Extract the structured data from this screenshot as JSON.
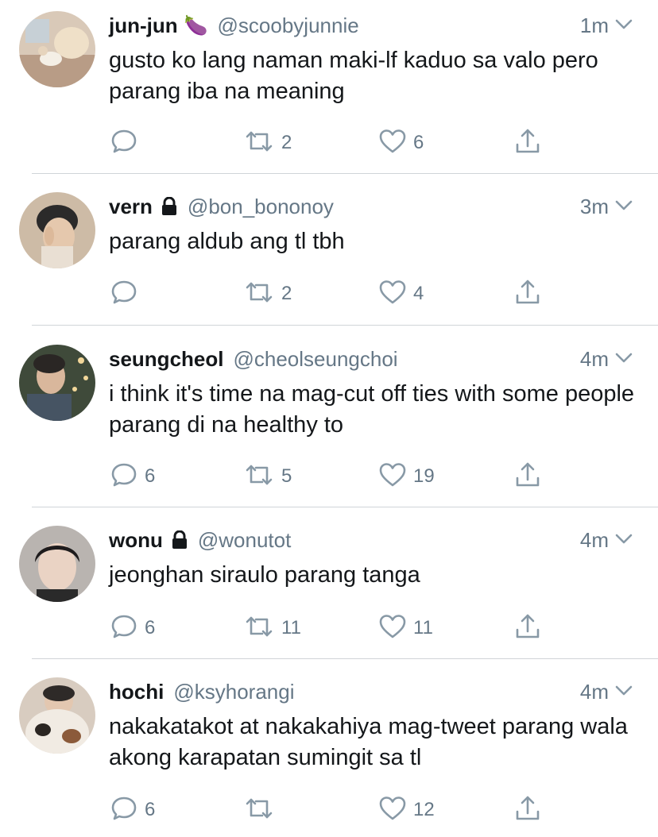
{
  "colors": {
    "name": "#14171a",
    "secondary": "#657786",
    "icon": "#8899a6",
    "divider": "#d0d4d8"
  },
  "tweets": [
    {
      "name": "jun-jun",
      "emoji": "🍆",
      "locked": false,
      "handle": "@scoobyjunnie",
      "time": "1m",
      "text": "gusto ko lang naman maki-lf kaduo sa valo pero parang iba na meaning",
      "replies": "",
      "retweets": "2",
      "likes": "6"
    },
    {
      "name": "vern",
      "emoji": "",
      "locked": true,
      "handle": "@bon_bononoy",
      "time": "3m",
      "text": "parang aldub ang tl tbh",
      "replies": "",
      "retweets": "2",
      "likes": "4"
    },
    {
      "name": "seungcheol",
      "emoji": "",
      "locked": false,
      "handle": "@cheolseungchoi",
      "time": "4m",
      "text": "i think it's time na mag-cut off ties with some people parang di na healthy to",
      "replies": "6",
      "retweets": "5",
      "likes": "19"
    },
    {
      "name": "wonu",
      "emoji": "",
      "locked": true,
      "handle": "@wonutot",
      "time": "4m",
      "text": "jeonghan siraulo parang tanga",
      "replies": "6",
      "retweets": "11",
      "likes": "11"
    },
    {
      "name": "hochi",
      "emoji": "",
      "locked": false,
      "handle": "@ksyhorangi",
      "time": "4m",
      "text": "nakakatakot at nakakahiya mag-tweet parang wala akong karapatan sumingit sa tl",
      "replies": "6",
      "retweets": "",
      "likes": "12"
    }
  ]
}
